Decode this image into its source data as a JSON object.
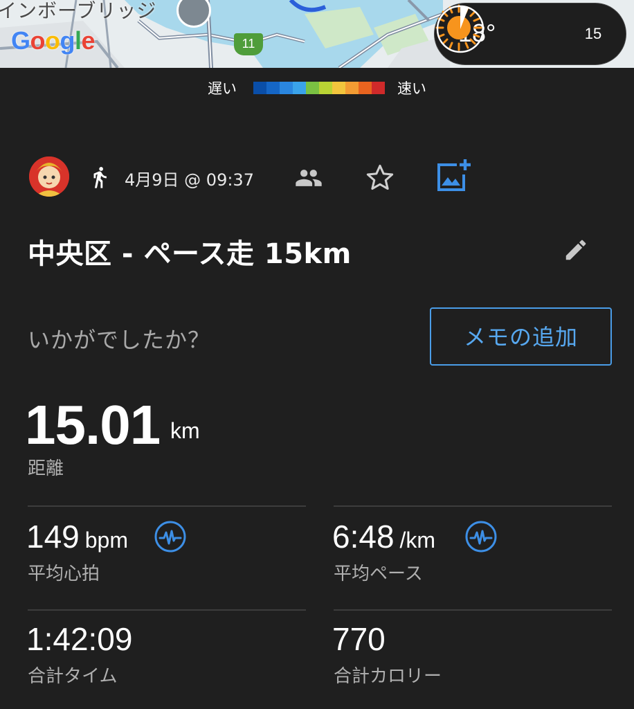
{
  "map": {
    "place_label": "インボーブリッジ",
    "logo": [
      "G",
      "o",
      "o",
      "g",
      "l",
      "e"
    ],
    "route_number": "11"
  },
  "weather": {
    "temperature": "18°",
    "icon": "sun-icon",
    "timer_value": "15"
  },
  "legend": {
    "slow_label": "遅い",
    "fast_label": "速い",
    "colors": [
      "#0a4ea8",
      "#1566c6",
      "#2a86df",
      "#3aa3ea",
      "#7ac142",
      "#b9d334",
      "#f2c53d",
      "#f39c33",
      "#e8641f",
      "#cf2a2a"
    ]
  },
  "activity": {
    "avatar_icon": "avatar",
    "type_icon": "running-icon",
    "datetime": "4月9日 @ 09:37",
    "title": "中央区 - ペース走 15km"
  },
  "prompt": {
    "question": "いかがでしたか？",
    "memo_button": "メモの追加"
  },
  "distance": {
    "value": "15.01",
    "unit": "km",
    "label": "距離"
  },
  "stats": {
    "heart_rate": {
      "value": "149",
      "unit": "bpm",
      "label": "平均心拍"
    },
    "pace": {
      "value": "6:48",
      "unit": "/km",
      "label": "平均ペース"
    },
    "total_time": {
      "value": "1:42:09",
      "label": "合計タイム"
    },
    "calories": {
      "value": "770",
      "label": "合計カロリー"
    }
  },
  "colors": {
    "background": "#1f1f1f",
    "accent_blue": "#4a9de8",
    "label_gray": "#b0b0b0"
  }
}
